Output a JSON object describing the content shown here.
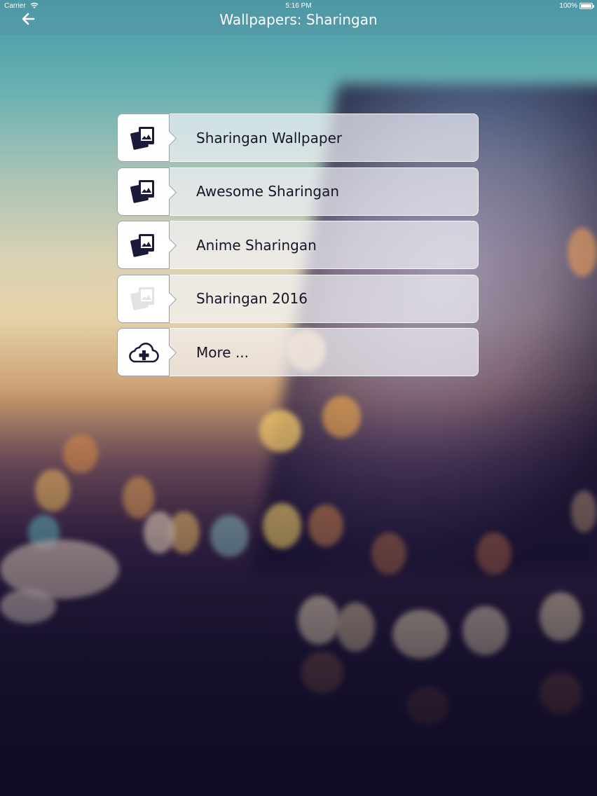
{
  "status_bar": {
    "carrier": "Carrier",
    "wifi_icon": "wifi-icon",
    "time": "5:16 PM",
    "battery_percent": "100%",
    "battery_icon": "battery-icon"
  },
  "nav": {
    "back_icon": "arrow-left-icon",
    "title": "Wallpapers: Sharingan"
  },
  "menu": {
    "items": [
      {
        "label": "Sharingan Wallpaper",
        "icon": "photos-icon",
        "dimmed": false
      },
      {
        "label": "Awesome Sharingan",
        "icon": "photos-icon",
        "dimmed": false
      },
      {
        "label": "Anime Sharingan",
        "icon": "photos-icon",
        "dimmed": false
      },
      {
        "label": "Sharingan 2016",
        "icon": "photos-icon",
        "dimmed": true
      },
      {
        "label": "More ...",
        "icon": "cloud-plus-icon",
        "dimmed": false
      }
    ]
  },
  "colors": {
    "icon_color": "#1c1a3a",
    "label_color": "#171528"
  }
}
